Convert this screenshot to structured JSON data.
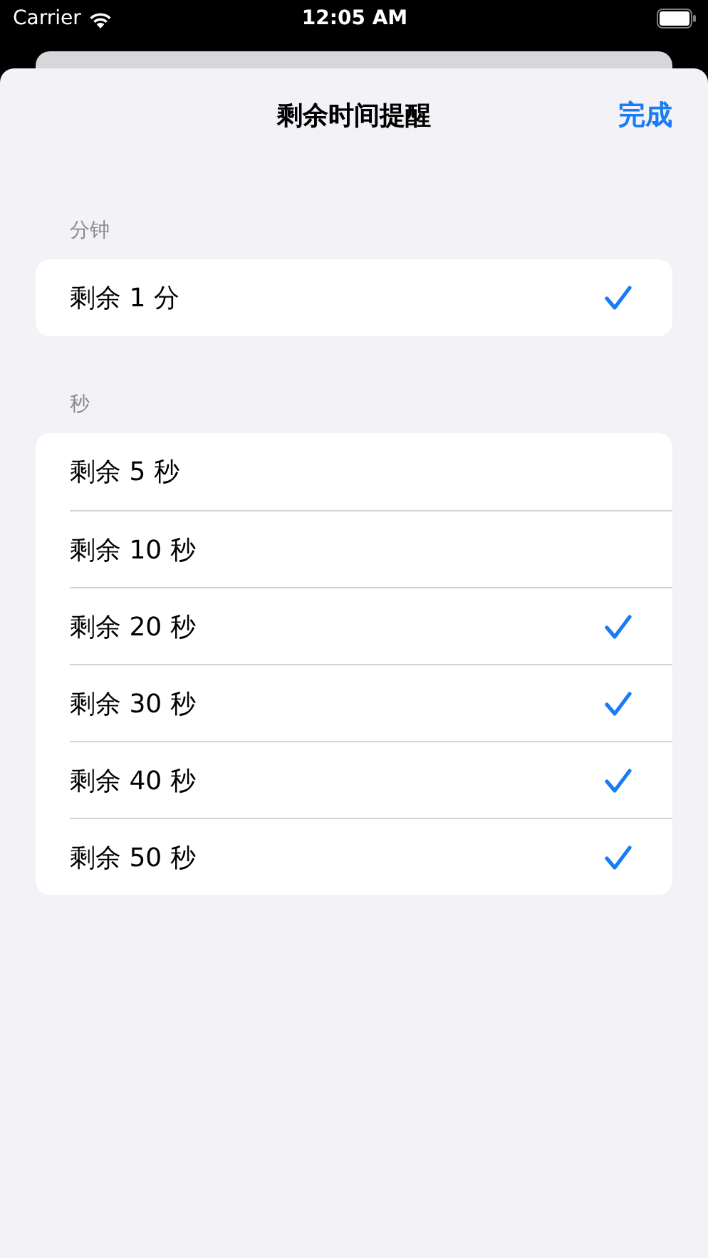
{
  "status_bar": {
    "carrier": "Carrier",
    "time": "12:05 AM"
  },
  "nav": {
    "title": "剩余时间提醒",
    "done": "完成"
  },
  "sections": [
    {
      "header": "分钟",
      "rows": [
        {
          "label": "剩余 1 分",
          "selected": true
        }
      ]
    },
    {
      "header": "秒",
      "rows": [
        {
          "label": "剩余 5 秒",
          "selected": false
        },
        {
          "label": "剩余 10 秒",
          "selected": false
        },
        {
          "label": "剩余 20 秒",
          "selected": true
        },
        {
          "label": "剩余 30 秒",
          "selected": true
        },
        {
          "label": "剩余 40 秒",
          "selected": true
        },
        {
          "label": "剩余 50 秒",
          "selected": true
        }
      ]
    }
  ]
}
